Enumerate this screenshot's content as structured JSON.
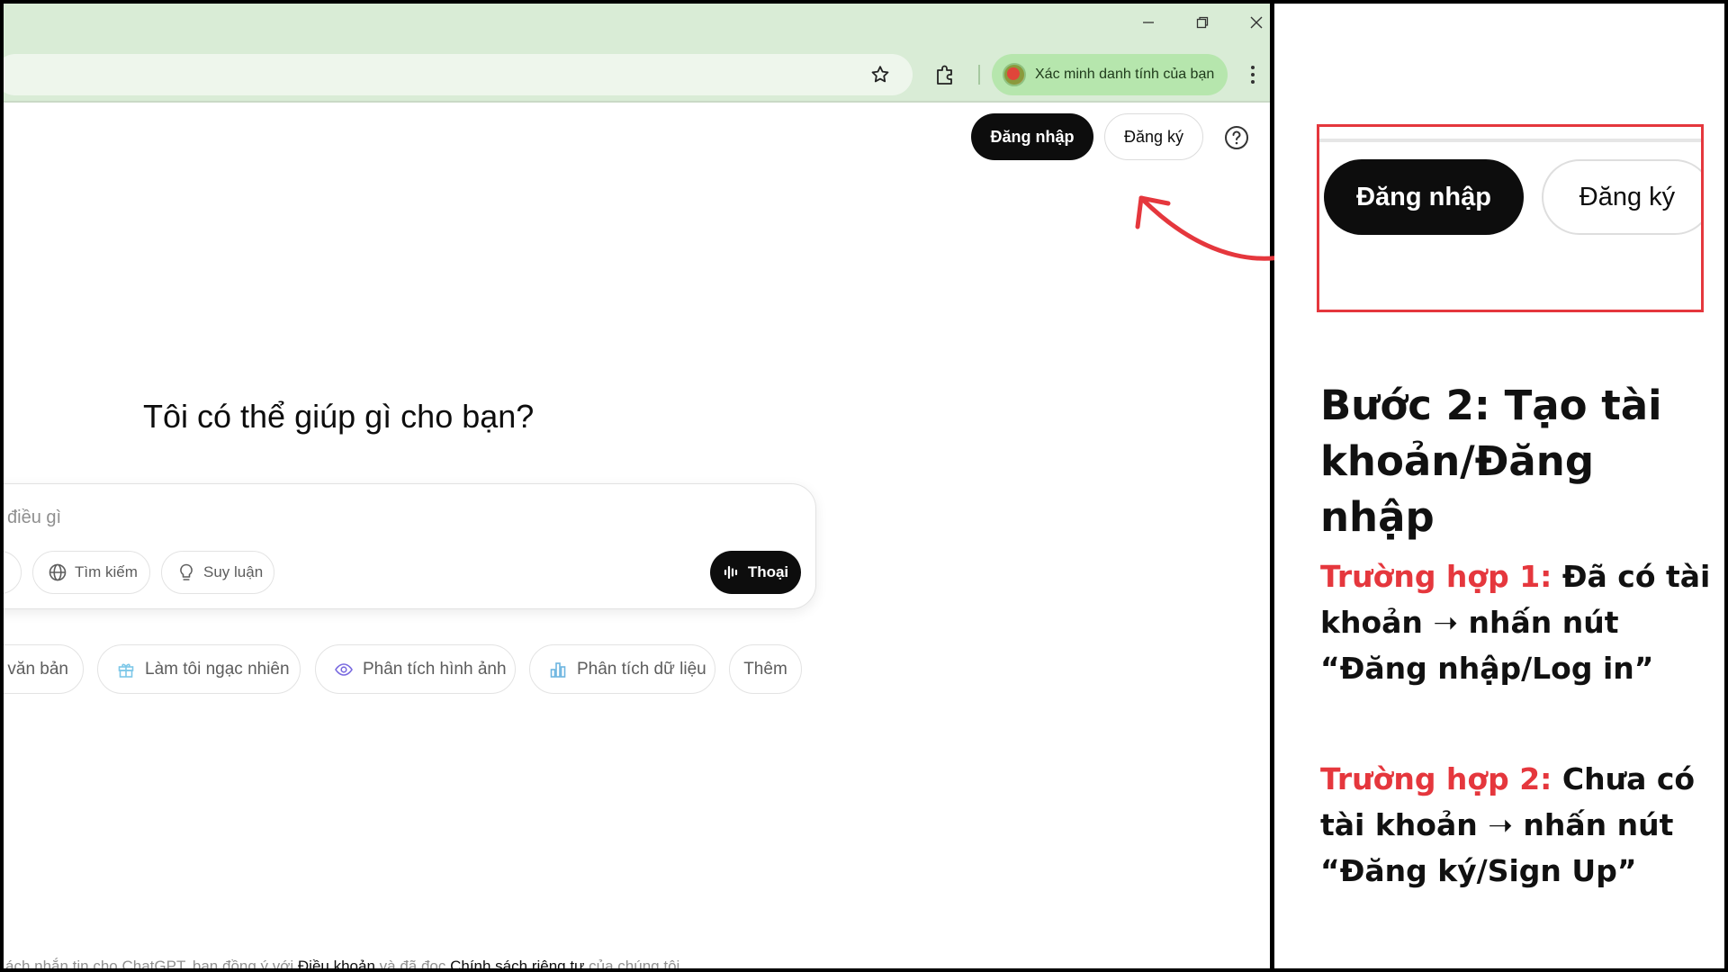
{
  "browser": {
    "profile_chip_label": "Xác minh danh tính của bạn",
    "theme_color": "#d9ecd6"
  },
  "header": {
    "login_label": "Đăng nhập",
    "signup_label": "Đăng ký"
  },
  "main": {
    "hero_title": "Tôi có thể giúp gì cho bạn?",
    "composer_placeholder_visible": "điều gì",
    "search_label": "Tìm kiếm",
    "reason_label": "Suy luận",
    "voice_label": "Thoại",
    "suggestions": [
      "văn bản",
      "Làm tôi ngạc nhiên",
      "Phân tích hình ảnh",
      "Phân tích dữ liệu",
      "Thêm"
    ]
  },
  "footer": {
    "prefix": "ách nhắn tin cho ChatGPT, bạn đồng ý với ",
    "terms": "Điều khoản",
    "middle": " và đã đọc ",
    "privacy": "Chính sách riêng tư",
    "suffix": " của chúng tôi."
  },
  "panel": {
    "zoom_login": "Đăng nhập",
    "zoom_signup": "Đăng ký",
    "step_title": "Bước 2: Tạo tài khoản/Đăng nhập",
    "case1_label": "Trường hợp 1:",
    "case1_text": " Đã có tài khoản ➝ nhấn nút “Đăng nhập/Log in”",
    "case2_label": "Trường hợp 2:",
    "case2_text": " Chưa có tài khoản ➝ nhấn nút “Đăng ký/Sign Up”",
    "accent_color": "#e5373d"
  }
}
